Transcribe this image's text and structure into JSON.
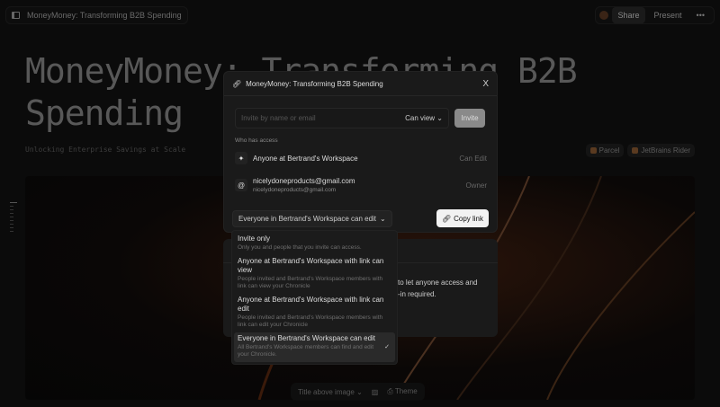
{
  "topbar": {
    "doc_title": "MoneyMoney: Transforming B2B Spending",
    "share": "Share",
    "present": "Present",
    "more": "•••"
  },
  "hero": {
    "title": "MoneyMoney: Transforming B2B Spending",
    "subtitle": "Unlocking Enterprise Savings at Scale",
    "tags": [
      "Parcel",
      "JetBrains Rider"
    ]
  },
  "bottom_bar": {
    "layout": "Title above image",
    "theme": "Theme"
  },
  "modal": {
    "title": "MoneyMoney: Transforming B2B Spending",
    "close": "X",
    "invite_placeholder": "Invite by name or email",
    "permission": "Can view",
    "invite_button": "Invite",
    "who_has_access": "Who has access",
    "access": [
      {
        "name": "Anyone at Bertrand's Workspace",
        "role": "Can Edit"
      },
      {
        "name": "nicelydoneproducts@gmail.com",
        "email": "nicelydoneproducts@gmail.com",
        "role": "Owner"
      }
    ],
    "link_setting": "Everyone in Bertrand's Workspace can edit",
    "copy_link": "Copy link"
  },
  "panel2": {
    "line1": "to let anyone access and",
    "line2": "-in required."
  },
  "dropdown": {
    "options": [
      {
        "title": "Invite only",
        "desc": "Only you and people that you invite can access."
      },
      {
        "title": "Anyone at Bertrand's Workspace with link can view",
        "desc": "People invited and Bertrand's Workspace members with link can view your Chronicle"
      },
      {
        "title": "Anyone at Bertrand's Workspace with link can edit",
        "desc": "People invited and Bertrand's Workspace members with link can edit your Chronicle"
      },
      {
        "title": "Everyone in Bertrand's Workspace can edit",
        "desc": "All Bertrand's Workspace members can find and edit your Chronicle.",
        "selected": true
      }
    ]
  }
}
